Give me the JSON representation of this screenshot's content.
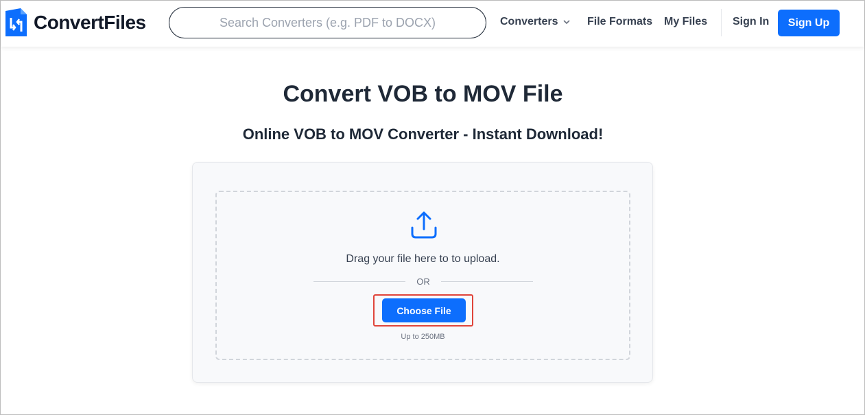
{
  "brand": {
    "name": "ConvertFiles",
    "accent": "#0d6efd"
  },
  "search": {
    "placeholder": "Search Converters (e.g. PDF to DOCX)"
  },
  "nav": {
    "converters": "Converters",
    "file_formats": "File Formats",
    "my_files": "My Files",
    "sign_in": "Sign In",
    "sign_up": "Sign Up"
  },
  "main": {
    "title": "Convert VOB to MOV File",
    "subtitle": "Online VOB to MOV Converter - Instant Download!"
  },
  "upload": {
    "icon": "upload-icon",
    "drag_text": "Drag your file here to to upload.",
    "or_text": "OR",
    "choose_label": "Choose File",
    "limit_text": "Up to 250MB",
    "highlight_color": "#e0443a"
  }
}
